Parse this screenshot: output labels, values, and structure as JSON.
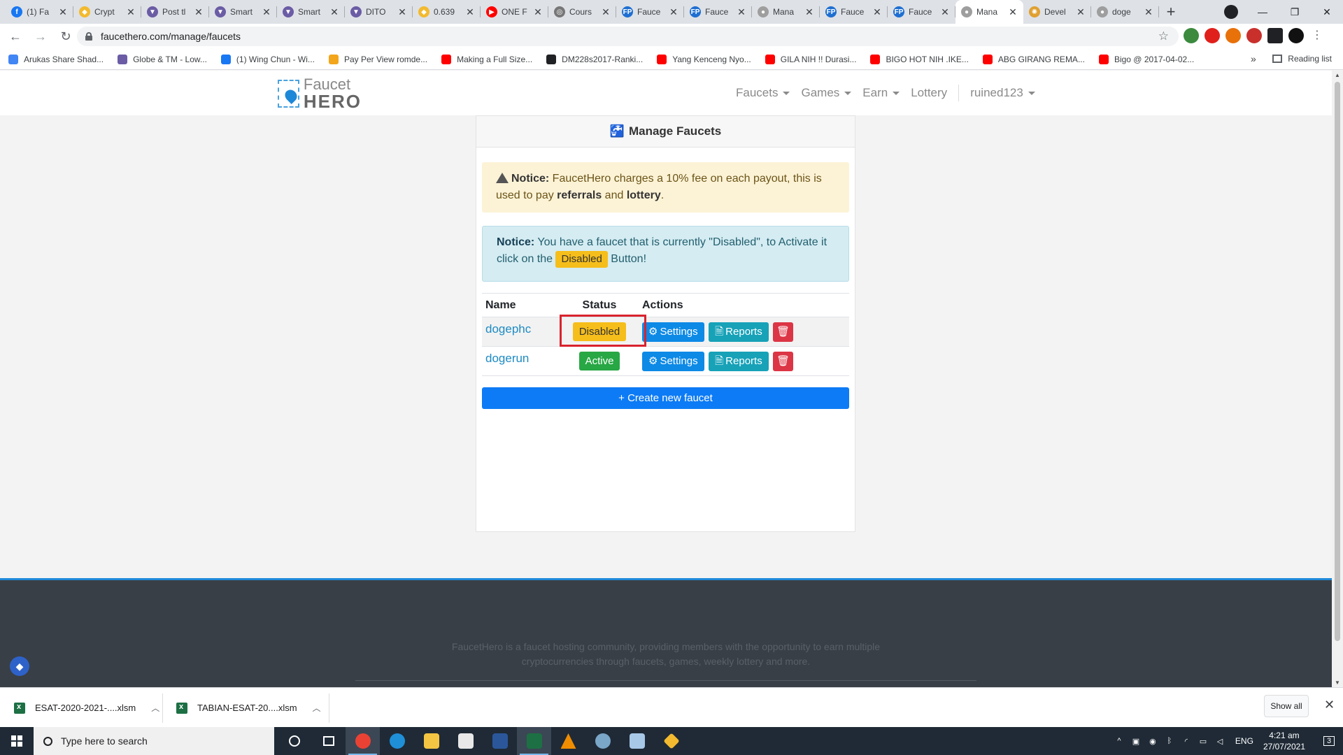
{
  "browser": {
    "tabs": [
      {
        "label": "(1) Fa",
        "color": "#1877f2",
        "glyph": "f"
      },
      {
        "label": "Crypt",
        "color": "#f3ba2f",
        "glyph": "◆"
      },
      {
        "label": "Post tl",
        "color": "#6b5ca5",
        "glyph": "▼"
      },
      {
        "label": "Smart",
        "color": "#6b5ca5",
        "glyph": "▼"
      },
      {
        "label": "Smart",
        "color": "#6b5ca5",
        "glyph": "▼"
      },
      {
        "label": "DITO",
        "color": "#6b5ca5",
        "glyph": "▼"
      },
      {
        "label": "0.639",
        "color": "#f3ba2f",
        "glyph": "◆"
      },
      {
        "label": "ONE F",
        "color": "#ff0000",
        "glyph": "▶"
      },
      {
        "label": "Cours",
        "color": "#777777",
        "glyph": "◎"
      },
      {
        "label": "Fauce",
        "color": "#1e6fd1",
        "glyph": "FP"
      },
      {
        "label": "Fauce",
        "color": "#1e6fd1",
        "glyph": "FP"
      },
      {
        "label": "Mana",
        "color": "#9e9e9e",
        "glyph": "●"
      },
      {
        "label": "Fauce",
        "color": "#1e6fd1",
        "glyph": "FP"
      },
      {
        "label": "Fauce",
        "color": "#1e6fd1",
        "glyph": "FP"
      },
      {
        "label": "Mana",
        "color": "#9e9e9e",
        "glyph": "●",
        "active": true
      },
      {
        "label": "Devel",
        "color": "#e0a030",
        "glyph": "✺"
      },
      {
        "label": "doge",
        "color": "#9e9e9e",
        "glyph": "●"
      }
    ],
    "url": "faucethero.com/manage/faucets",
    "bookmarks": [
      {
        "label": "Arukas Share Shad...",
        "color": "#4285f4"
      },
      {
        "label": "Globe & TM - Low...",
        "color": "#6b5ca5"
      },
      {
        "label": "(1) Wing Chun - Wi...",
        "color": "#1877f2"
      },
      {
        "label": "Pay Per View romde...",
        "color": "#f3a51b"
      },
      {
        "label": "Making a Full Size...",
        "color": "#ff0000"
      },
      {
        "label": "DM228s2017-Ranki...",
        "color": "#202124"
      },
      {
        "label": "Yang Kenceng Nyo...",
        "color": "#ff0000"
      },
      {
        "label": "GILA NIH !! Durasi...",
        "color": "#ff0000"
      },
      {
        "label": "BIGO HOT NIH .IKE...",
        "color": "#ff0000"
      },
      {
        "label": "ABG GIRANG REMA...",
        "color": "#ff0000"
      },
      {
        "label": "Bigo @ 2017-04-02...",
        "color": "#ff0000"
      }
    ],
    "more_bookmarks": "»",
    "reading_list": "Reading list"
  },
  "site": {
    "logo_top": "Faucet",
    "logo_bottom": "HERO",
    "menu": {
      "faucets": "Faucets",
      "games": "Games",
      "earn": "Earn",
      "lottery": "Lottery",
      "user": "ruined123"
    }
  },
  "card": {
    "title": "Manage Faucets",
    "warning": {
      "lead": "Notice:",
      "text1": " FaucetHero charges a 10% fee on each payout, this is used to pay ",
      "b1": "referrals",
      "text2": " and ",
      "b2": "lottery",
      "text3": "."
    },
    "info": {
      "lead": "Notice:",
      "text1": " You have a faucet that is currently \"Disabled\", to Activate it click on the ",
      "badge": "Disabled",
      "text2": " Button!"
    },
    "table": {
      "headers": {
        "name": "Name",
        "status": "Status",
        "actions": "Actions"
      },
      "rows": [
        {
          "name": "dogephc",
          "status": "Disabled",
          "settings": "Settings",
          "reports": "Reports"
        },
        {
          "name": "dogerun",
          "status": "Active",
          "settings": "Settings",
          "reports": "Reports"
        }
      ]
    },
    "create_button": "+ Create new faucet"
  },
  "footer": {
    "text": "FaucetHero is a faucet hosting community, providing members with the opportunity to earn multiple cryptocurrencies through faucets, games, weekly lottery and more."
  },
  "downloads": {
    "items": [
      {
        "name": "ESAT-2020-2021-....xlsm"
      },
      {
        "name": "TABIAN-ESAT-20....xlsm"
      }
    ],
    "show_all": "Show all"
  },
  "taskbar": {
    "search_placeholder": "Type here to search",
    "lang": "ENG",
    "time": "4:21 am",
    "date": "27/07/2021",
    "notification_count": "3"
  },
  "colors": {
    "accent_blue": "#0d7bf5",
    "warning_yellow": "#f6be1b",
    "success_green": "#28a745",
    "danger_red": "#dc3545",
    "highlight_red": "#d9232e"
  }
}
